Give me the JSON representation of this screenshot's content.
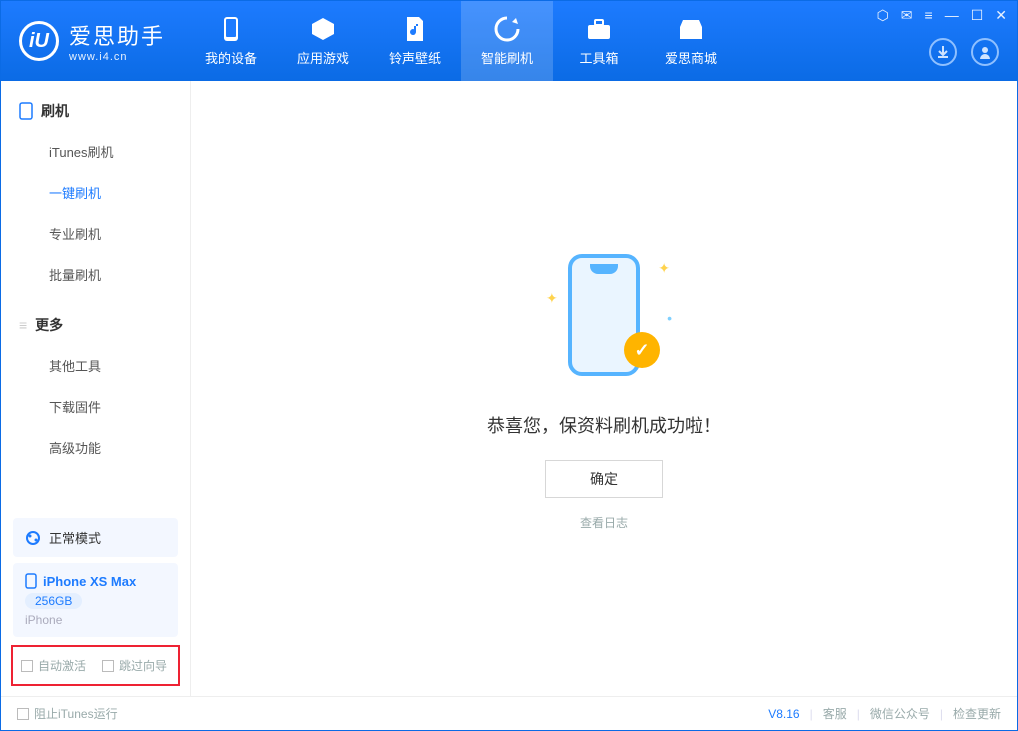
{
  "brand": {
    "cn": "爱思助手",
    "en": "www.i4.cn"
  },
  "nav": {
    "tabs": [
      {
        "label": "我的设备"
      },
      {
        "label": "应用游戏"
      },
      {
        "label": "铃声壁纸"
      },
      {
        "label": "智能刷机"
      },
      {
        "label": "工具箱"
      },
      {
        "label": "爱思商城"
      }
    ]
  },
  "sidebar": {
    "group_flash": "刷机",
    "items_flash": [
      {
        "label": "iTunes刷机"
      },
      {
        "label": "一键刷机"
      },
      {
        "label": "专业刷机"
      },
      {
        "label": "批量刷机"
      }
    ],
    "group_more": "更多",
    "items_more": [
      {
        "label": "其他工具"
      },
      {
        "label": "下载固件"
      },
      {
        "label": "高级功能"
      }
    ],
    "mode": "正常模式",
    "device": {
      "name": "iPhone XS Max",
      "capacity": "256GB",
      "type": "iPhone"
    },
    "opt_auto_activate": "自动激活",
    "opt_skip_wizard": "跳过向导"
  },
  "main": {
    "success_text": "恭喜您，保资料刷机成功啦！",
    "ok_button": "确定",
    "view_log": "查看日志"
  },
  "status": {
    "block_itunes": "阻止iTunes运行",
    "version": "V8.16",
    "support": "客服",
    "wechat": "微信公众号",
    "check_update": "检查更新"
  }
}
